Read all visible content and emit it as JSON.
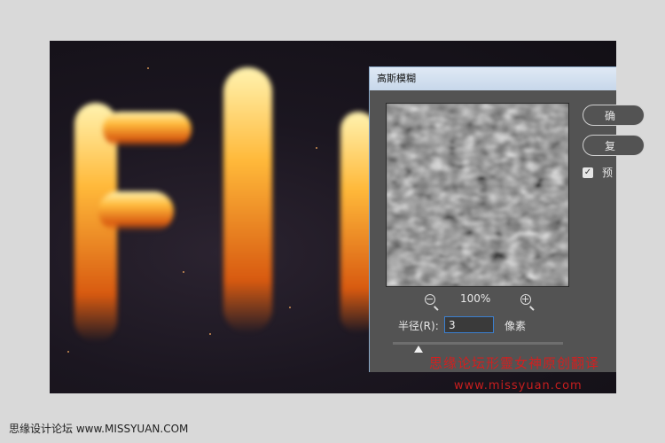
{
  "dialog": {
    "title": "高斯模糊",
    "ok_label": "确",
    "reset_label": "复",
    "preview_label": "预",
    "zoom_level": "100%",
    "radius_label": "半径(R):",
    "radius_value": "3",
    "unit_label": "像素",
    "slider_position": 0.15
  },
  "watermark": {
    "line1": "思缘论坛形靈女神原创翻译",
    "line2": "www.missyuan.com"
  },
  "footer": {
    "text": "思缘设计论坛 www.MISSYUAN.COM"
  }
}
